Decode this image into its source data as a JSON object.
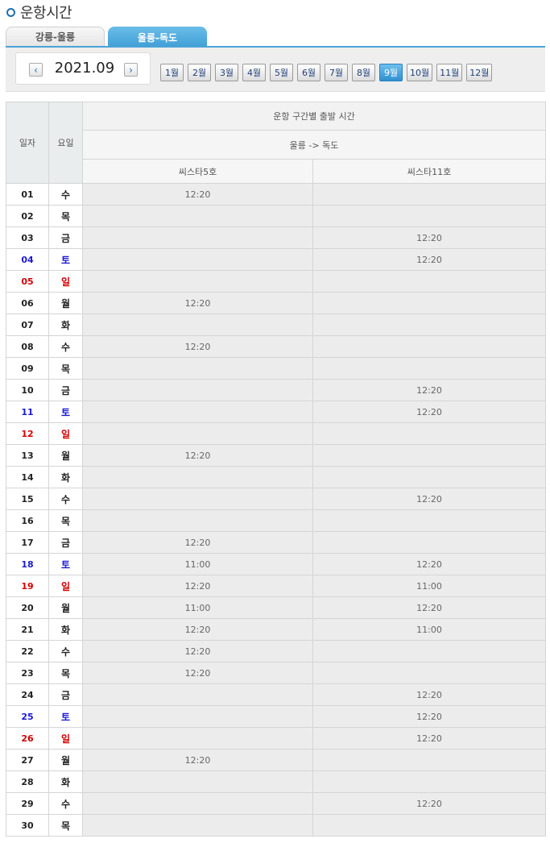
{
  "page": {
    "title": "운항시간"
  },
  "tabs": [
    {
      "label": "강릉-울릉",
      "active": false
    },
    {
      "label": "울릉-독도",
      "active": true
    }
  ],
  "month_nav": {
    "current": "2021.09",
    "months": [
      "1월",
      "2월",
      "3월",
      "4월",
      "5월",
      "6월",
      "7월",
      "8월",
      "9월",
      "10월",
      "11월",
      "12월"
    ],
    "selected_index": 8
  },
  "table": {
    "col_day": "일자",
    "col_dow": "요일",
    "col_group": "운항 구간별 출발 시간",
    "route": "울릉 -> 독도",
    "vessels": [
      "씨스타5호",
      "씨스타11호"
    ],
    "rows": [
      {
        "day": "01",
        "dow": "수",
        "type": "weekday",
        "t1": "12:20",
        "t2": ""
      },
      {
        "day": "02",
        "dow": "목",
        "type": "weekday",
        "t1": "",
        "t2": ""
      },
      {
        "day": "03",
        "dow": "금",
        "type": "weekday",
        "t1": "",
        "t2": "12:20"
      },
      {
        "day": "04",
        "dow": "토",
        "type": "sat",
        "t1": "",
        "t2": "12:20"
      },
      {
        "day": "05",
        "dow": "일",
        "type": "sun",
        "t1": "",
        "t2": ""
      },
      {
        "day": "06",
        "dow": "월",
        "type": "weekday",
        "t1": "12:20",
        "t2": ""
      },
      {
        "day": "07",
        "dow": "화",
        "type": "weekday",
        "t1": "",
        "t2": ""
      },
      {
        "day": "08",
        "dow": "수",
        "type": "weekday",
        "t1": "12:20",
        "t2": ""
      },
      {
        "day": "09",
        "dow": "목",
        "type": "weekday",
        "t1": "",
        "t2": ""
      },
      {
        "day": "10",
        "dow": "금",
        "type": "weekday",
        "t1": "",
        "t2": "12:20"
      },
      {
        "day": "11",
        "dow": "토",
        "type": "sat",
        "t1": "",
        "t2": "12:20"
      },
      {
        "day": "12",
        "dow": "일",
        "type": "sun",
        "t1": "",
        "t2": ""
      },
      {
        "day": "13",
        "dow": "월",
        "type": "weekday",
        "t1": "12:20",
        "t2": ""
      },
      {
        "day": "14",
        "dow": "화",
        "type": "weekday",
        "t1": "",
        "t2": ""
      },
      {
        "day": "15",
        "dow": "수",
        "type": "weekday",
        "t1": "",
        "t2": "12:20"
      },
      {
        "day": "16",
        "dow": "목",
        "type": "weekday",
        "t1": "",
        "t2": ""
      },
      {
        "day": "17",
        "dow": "금",
        "type": "weekday",
        "t1": "12:20",
        "t2": ""
      },
      {
        "day": "18",
        "dow": "토",
        "type": "sat",
        "t1": "11:00",
        "t2": "12:20"
      },
      {
        "day": "19",
        "dow": "일",
        "type": "sun",
        "t1": "12:20",
        "t2": "11:00"
      },
      {
        "day": "20",
        "dow": "월",
        "type": "weekday",
        "t1": "11:00",
        "t2": "12:20"
      },
      {
        "day": "21",
        "dow": "화",
        "type": "weekday",
        "t1": "12:20",
        "t2": "11:00"
      },
      {
        "day": "22",
        "dow": "수",
        "type": "weekday",
        "t1": "12:20",
        "t2": ""
      },
      {
        "day": "23",
        "dow": "목",
        "type": "weekday",
        "t1": "12:20",
        "t2": ""
      },
      {
        "day": "24",
        "dow": "금",
        "type": "weekday",
        "t1": "",
        "t2": "12:20"
      },
      {
        "day": "25",
        "dow": "토",
        "type": "sat",
        "t1": "",
        "t2": "12:20"
      },
      {
        "day": "26",
        "dow": "일",
        "type": "sun",
        "t1": "",
        "t2": "12:20"
      },
      {
        "day": "27",
        "dow": "월",
        "type": "weekday",
        "t1": "12:20",
        "t2": ""
      },
      {
        "day": "28",
        "dow": "화",
        "type": "weekday",
        "t1": "",
        "t2": ""
      },
      {
        "day": "29",
        "dow": "수",
        "type": "weekday",
        "t1": "",
        "t2": "12:20"
      },
      {
        "day": "30",
        "dow": "목",
        "type": "weekday",
        "t1": "",
        "t2": ""
      }
    ]
  },
  "colors": {
    "accent": "#3f9fd6",
    "saturday": "#1a1ad4",
    "sunday": "#d40000"
  },
  "icons": {
    "prev": "chevron-left-icon",
    "next": "chevron-right-icon",
    "bullet": "circle-bullet-icon"
  }
}
